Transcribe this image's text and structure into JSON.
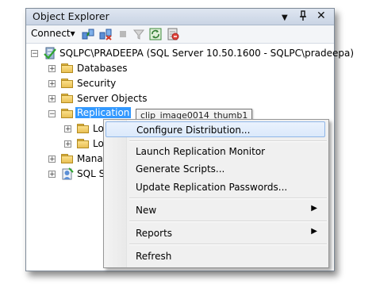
{
  "window": {
    "title": "Object Explorer",
    "pin_glyph": "⮟",
    "dropdown_glyph": "▼",
    "close_glyph": "✕"
  },
  "toolbar": {
    "connect_label": "Connect",
    "connect_arrow": "▾",
    "buttons": [
      "connect-object-explorer-icon",
      "disconnect-icon",
      "stop-icon",
      "filter-icon",
      "refresh-icon",
      "server-activity-icon"
    ]
  },
  "tree": {
    "server": "SQLPC\\PRADEEPA (SQL Server 10.50.1600 - SQLPC\\pradeepa)",
    "databases": "Databases",
    "security": "Security",
    "server_objects": "Server Objects",
    "replication": "Replication",
    "local_publications": "Loc",
    "local_subscriptions": "Loc",
    "management": "Manag",
    "sql_server_agent": "SQL Se",
    "expand": "+",
    "collapse": "−"
  },
  "tooltip": {
    "text": "clip_image0014_thumb1"
  },
  "context_menu": {
    "items": [
      {
        "label": "Configure Distribution...",
        "highlighted": true
      },
      {
        "label": "Launch Replication Monitor"
      },
      {
        "label": "Generate Scripts..."
      },
      {
        "label": "Update Replication Passwords..."
      },
      {
        "label": "New",
        "submenu": true
      },
      {
        "label": "Reports",
        "submenu": true
      },
      {
        "label": "Refresh"
      }
    ],
    "submenu_arrow": "▶"
  },
  "colors": {
    "selection": "#3399ff",
    "highlight_border": "#8fb6e8"
  }
}
